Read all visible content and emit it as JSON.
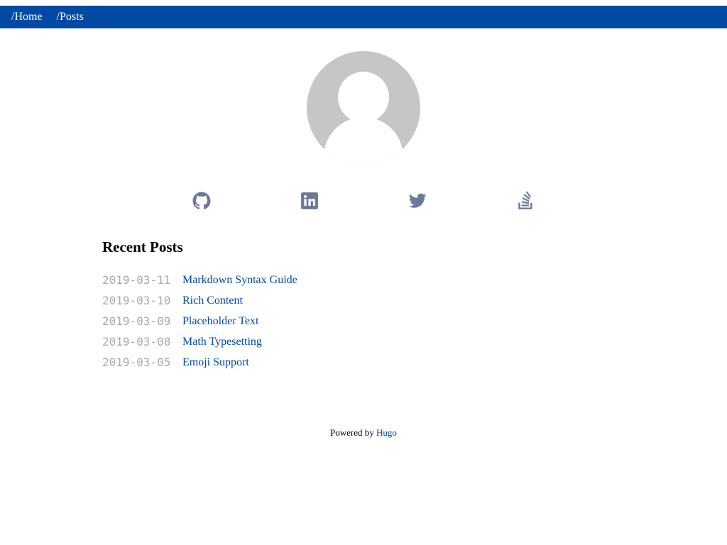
{
  "nav": {
    "items": [
      {
        "label": "/Home"
      },
      {
        "label": "/Posts"
      }
    ]
  },
  "social": {
    "icon_color": "#6b7a99",
    "icons": [
      "github-icon",
      "linkedin-icon",
      "twitter-icon",
      "stackoverflow-icon"
    ]
  },
  "recent": {
    "title": "Recent Posts",
    "posts": [
      {
        "date": "2019-03-11",
        "title": "Markdown Syntax Guide"
      },
      {
        "date": "2019-03-10",
        "title": "Rich Content"
      },
      {
        "date": "2019-03-09",
        "title": "Placeholder Text"
      },
      {
        "date": "2019-03-08",
        "title": "Math Typesetting"
      },
      {
        "date": "2019-03-05",
        "title": "Emoji Support"
      }
    ]
  },
  "footer": {
    "prefix": "Powered by",
    "link": "Hugo"
  },
  "colors": {
    "accent": "#004aa4",
    "date": "#a9a9a9",
    "avatar_bg": "#c6c6c6"
  }
}
